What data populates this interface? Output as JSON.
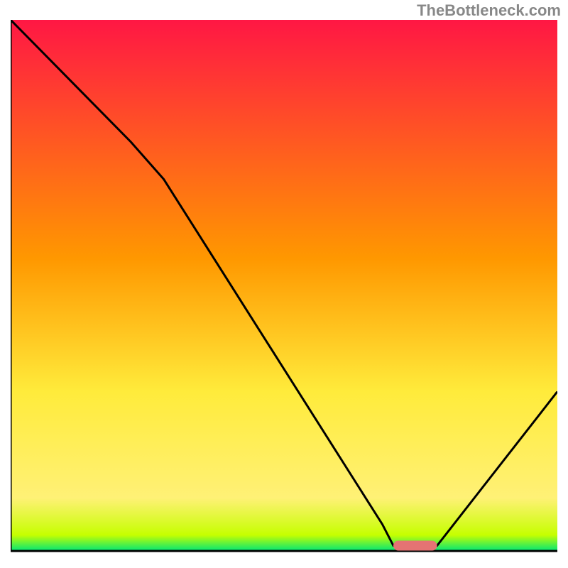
{
  "watermark": "TheBottleneck.com",
  "chart_data": {
    "type": "line",
    "title": "",
    "xlabel": "",
    "ylabel": "",
    "xlim": [
      0,
      100
    ],
    "ylim": [
      0,
      100
    ],
    "gradient_colors": {
      "top": "#ff1744",
      "mid1": "#ff9800",
      "mid2": "#ffeb3b",
      "mid3": "#fff176",
      "bottom": "#00e676"
    },
    "curve": [
      {
        "x": 0,
        "y": 100
      },
      {
        "x": 22,
        "y": 77
      },
      {
        "x": 28,
        "y": 70
      },
      {
        "x": 68,
        "y": 5
      },
      {
        "x": 70,
        "y": 1
      },
      {
        "x": 78,
        "y": 1
      },
      {
        "x": 100,
        "y": 30
      }
    ],
    "marker": {
      "x_start": 70,
      "x_end": 78,
      "y": 1,
      "color": "#e57373"
    }
  }
}
